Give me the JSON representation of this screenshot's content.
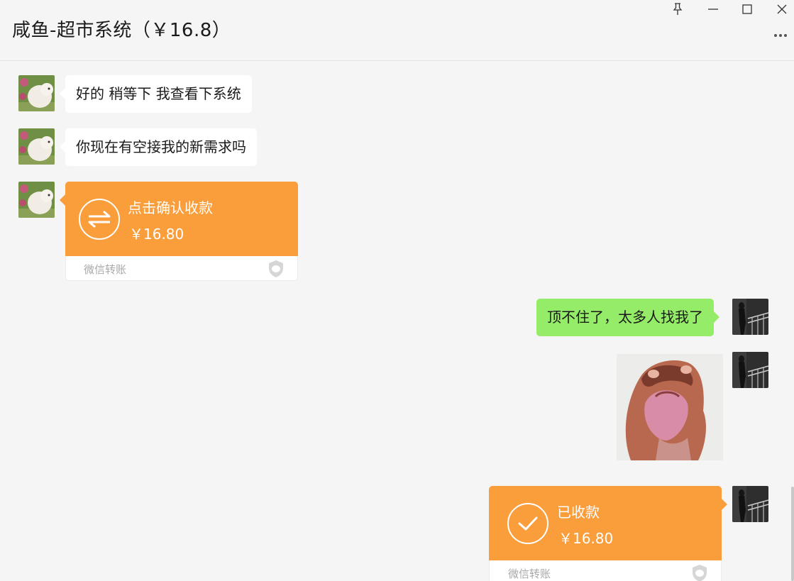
{
  "window": {
    "title": "咸鱼-超市系统（￥16.8）",
    "controls": [
      "pin-icon",
      "minimize-icon",
      "maximize-icon",
      "close-icon"
    ],
    "more_icon": "more-dots-icon"
  },
  "messages": [
    {
      "side": "in",
      "type": "text",
      "text": "好的 稍等下 我查看下系统"
    },
    {
      "side": "in",
      "type": "text",
      "text": "你现在有空接我的新需求吗"
    },
    {
      "side": "in",
      "type": "transfer",
      "title": "点击确认收款",
      "amount": "￥16.80",
      "label": "微信转账",
      "icon": "transfer-arrows-icon"
    },
    {
      "side": "out",
      "type": "text",
      "text": "顶不住了，太多人找我了"
    },
    {
      "side": "out",
      "type": "sticker",
      "icon": "cat-sticker"
    },
    {
      "side": "out",
      "type": "transfer",
      "title": "已收款",
      "amount": "￥16.80",
      "label": "微信转账",
      "icon": "check-icon"
    }
  ],
  "colors": {
    "background": "#f5f5f5",
    "incoming_bubble": "#ffffff",
    "outgoing_bubble": "#95ec69",
    "transfer": "#fa9d3b"
  }
}
